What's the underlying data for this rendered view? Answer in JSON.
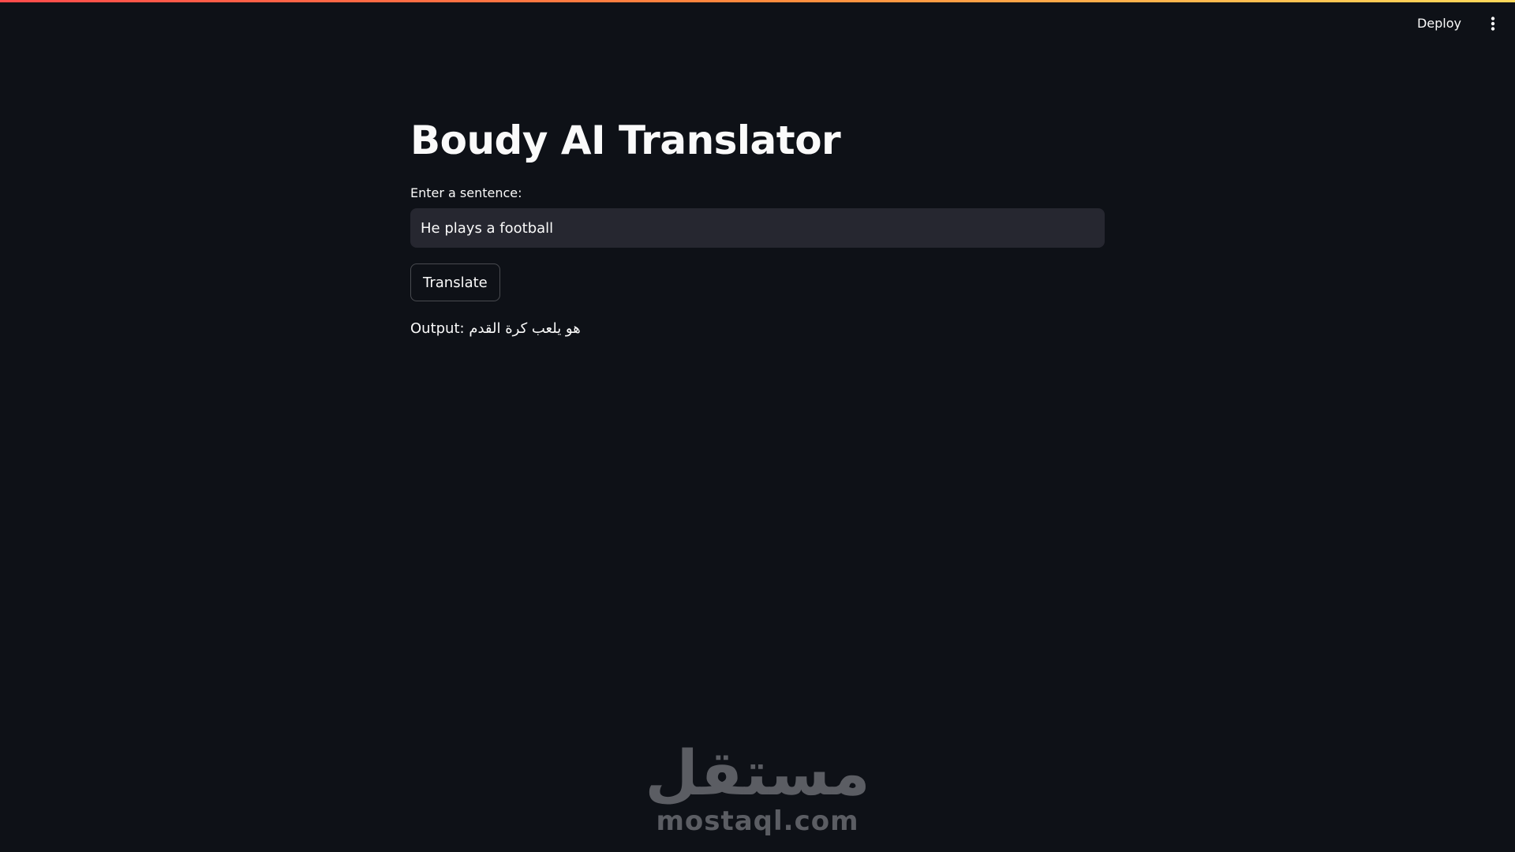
{
  "header": {
    "deploy_label": "Deploy",
    "menu_icon": "kebab-menu-icon"
  },
  "main": {
    "title": "Boudy AI Translator",
    "input_label": "Enter a sentence:",
    "input_value": "He plays a football",
    "button_label": "Translate",
    "output_text": "Output: هو يلعب كرة القدم"
  },
  "watermark": {
    "arabic": "مستقل",
    "latin": "mostaql.com"
  },
  "colors": {
    "background": "#0e1117",
    "input_background": "#262730",
    "text": "#fafafa",
    "accent_gradient_start": "#ff4b4b",
    "accent_gradient_end": "#ffd95a"
  }
}
